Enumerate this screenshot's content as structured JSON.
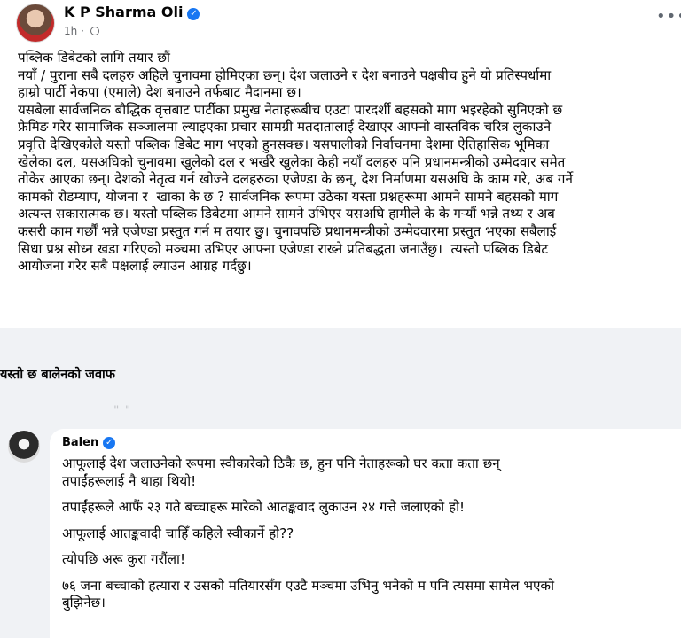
{
  "post": {
    "author": "K P Sharma Oli",
    "time": "1h",
    "more_label": "•••",
    "body": [
      "पब्लिक डिबेटको लागि तयार छौं",
      "नयाँ / पुराना सबै दलहरु अहिले चुनावमा होमिएका छन्। देश जलाउने र देश बनाउने पक्षबीच हुने यो प्रतिस्पर्धामा",
      "हाम्रो पार्टी नेकपा (एमाले) देश बनाउने तर्फबाट मैदानमा छ।",
      "यसबेला सार्वजनिक बौद्धिक वृत्तबाट पार्टीका प्रमुख नेताहरूबीच एउटा पारदर्शी बहसको माग भइरहेको सुनिएको छ",
      "फ्रेमिङ गरेर सामाजिक सञ्जालमा ल्याइएका प्रचार सामग्री मतदातालाई देखाएर आफ्नो वास्तविक चरित्र लुकाउने",
      "प्रवृत्ति देखिएकोले यस्तो पब्लिक डिबेट माग भएको हुनसक्छ। यसपालीको निर्वाचनमा देशमा ऐतिहासिक भूमिका",
      "खेलेका दल, यसअघिको चुनावमा खुलेको दल र भर्खरै खुलेका केही नयाँ दलहरु पनि प्रधानमन्त्रीको उम्मेदवार समेत",
      "तोकेर आएका छन्। देशको नेतृत्व गर्न खोज्ने दलहरुका एजेण्डा के छन्, देश निर्माणमा यसअघि के काम गरे, अब गर्ने",
      "कामको रोडम्याप, योजना र  खाका के छ ? सार्वजनिक रूपमा उठेका यस्ता प्रश्नहरूमा आमने सामने बहसको माग",
      "अत्यन्त सकारात्मक छ। यस्तो पब्लिक डिबेटमा आमने सामने उभिएर यसअघि हामीले के के गर्‍यौं भन्ने तथ्य र अब",
      "कसरी काम गर्छौं भन्ने एजेण्डा प्रस्तुत गर्न म तयार छु। चुनावपछि प्रधानमन्त्रीको उम्मेदवारमा प्रस्तुत भएका सबैलाई",
      "सिधा प्रश्न सोध्न खडा गरिएको मञ्चमा उभिएर आफ्ना एजेण्डा राख्ने प्रतिबद्धता जनाउँछु।  त्यस्तो पब्लिक डिबेट",
      "आयोजना गरेर सबै पक्षलाई ल्याउन आग्रह गर्दछु।"
    ]
  },
  "heading": "यस्तो छ बालेनको जवाफ",
  "separator": "\" \"",
  "comment": {
    "author": "Balen",
    "lines": [
      "आफूलाई देश जलाउनेको रूपमा स्वीकारेको ठिकै छ, हुन पनि नेताहरूको घर कता कता छन्\nतपाईंहरूलाई नै थाहा थियो!",
      "तपाईंहरूले आफैं २३ गते बच्चाहरू मारेको आतङ्कवाद लुकाउन २४ गत्ते जलाएको हो!",
      "आफूलाई आतङ्कवादी चाहिँ कहिले स्वीकार्ने हो??",
      "त्योपछि अरू कुरा गरौंला!",
      "७६ जना बच्चाको हत्यारा र उसको मतियारसँग एउटै मञ्चमा उभिनु भनेको म पनि त्यसमा सामेल भएको\nबुझिनेछ।"
    ]
  },
  "colors": {
    "verified": "#1877f2",
    "band": "#f0f2f5",
    "meta_text": "#65676b"
  },
  "icons": [
    "verified-badge-icon",
    "globe-icon",
    "more-options-icon"
  ]
}
